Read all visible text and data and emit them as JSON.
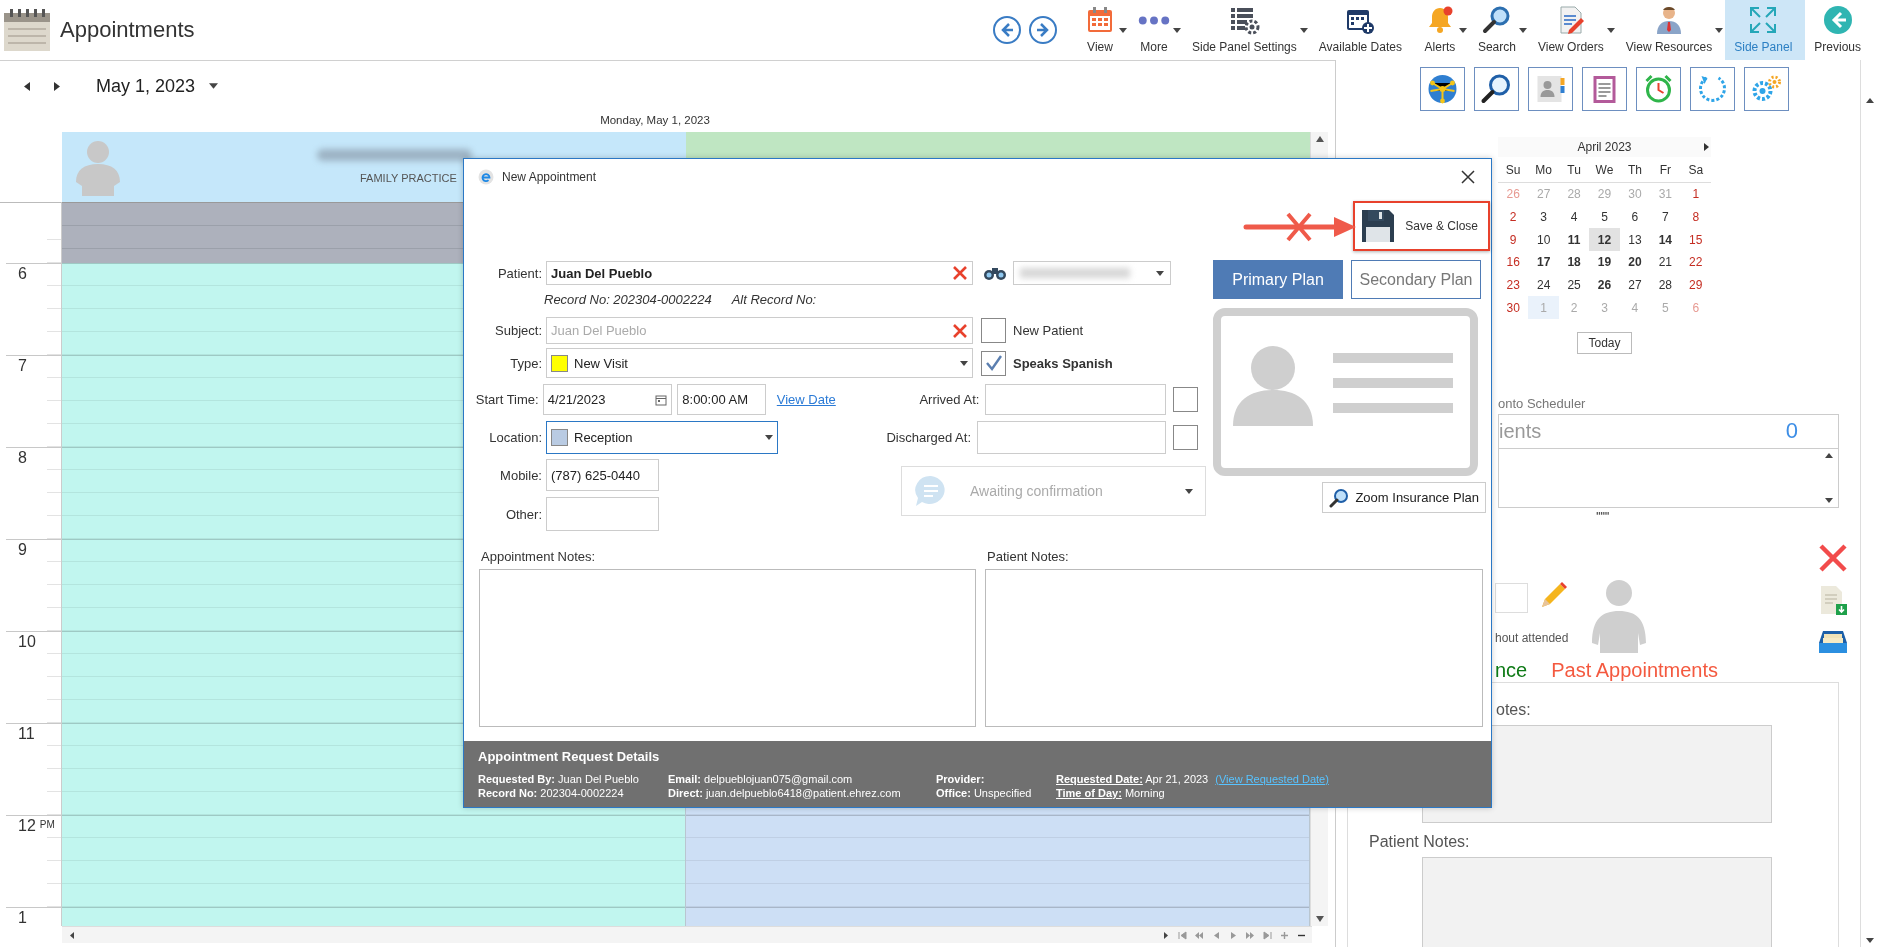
{
  "app": {
    "title": "Appointments"
  },
  "toolbar": [
    {
      "label": "View",
      "kind": "calendar",
      "dropdown": true,
      "selected": false
    },
    {
      "label": "More",
      "kind": "dots",
      "dropdown": true,
      "selected": false
    },
    {
      "label": "Side Panel Settings",
      "kind": "list-gear",
      "dropdown": true,
      "selected": false
    },
    {
      "label": "Available Dates",
      "kind": "calendar-plus",
      "dropdown": false,
      "selected": false
    },
    {
      "label": "Alerts",
      "kind": "bell",
      "dropdown": true,
      "selected": false
    },
    {
      "label": "Search",
      "kind": "search",
      "dropdown": true,
      "selected": false
    },
    {
      "label": "View Orders",
      "kind": "document",
      "dropdown": true,
      "selected": false
    },
    {
      "label": "View Resources",
      "kind": "person",
      "dropdown": true,
      "selected": false
    },
    {
      "label": "Side Panel",
      "kind": "expand",
      "dropdown": false,
      "selected": true
    },
    {
      "label": "Previous",
      "kind": "back",
      "dropdown": false,
      "selected": false
    }
  ],
  "date_nav": {
    "date": "May 1, 2023"
  },
  "scheduler": {
    "day_title": "Monday, May 1, 2023",
    "resources": [
      {
        "subtitle": "FAMILY PRACTICE",
        "header": {
          "color": "#c5e7fa"
        },
        "body": {
          "color": "#c1f6ef"
        }
      },
      {
        "header": {
          "color": "#bfe6c2"
        },
        "body": {
          "color": "#cddff5"
        }
      }
    ],
    "hours": [
      {
        "hour": "6"
      },
      {
        "hour": "7"
      },
      {
        "hour": "8"
      },
      {
        "hour": "9"
      },
      {
        "hour": "10"
      },
      {
        "hour": "11"
      },
      {
        "hour": "12",
        "suffix": "PM"
      },
      {
        "hour": "1"
      }
    ]
  },
  "dialog": {
    "title": "New Appointment",
    "save_button": "Save & Close",
    "patient": {
      "label": "Patient:",
      "value": "Juan Del Pueblo"
    },
    "record_no": "Record No: 202304-0002224",
    "alt_record_no": "Alt Record No:",
    "subject": {
      "label": "Subject:",
      "placeholder": "Juan Del Pueblo"
    },
    "new_patient": {
      "label": "New Patient",
      "checked": false
    },
    "type": {
      "label": "Type:",
      "value": "New Visit",
      "color": "#ffff00"
    },
    "speaks_spanish": {
      "label": "Speaks Spanish",
      "checked": true
    },
    "start_time": {
      "label": "Start Time:",
      "date": "4/21/2023",
      "time": "8:00:00 AM",
      "link": "View Date"
    },
    "arrived_at": {
      "label": "Arrived At:",
      "checked": false
    },
    "location": {
      "label": "Location:",
      "value": "Reception",
      "color": "#b9cbe3"
    },
    "discharged_at": {
      "label": "Discharged At:",
      "checked": false
    },
    "mobile": {
      "label": "Mobile:",
      "value": "(787) 625-0440"
    },
    "other": {
      "label": "Other:"
    },
    "status": {
      "value": "Awaiting confirmation",
      "disabled": true
    },
    "plans": [
      {
        "label": "Primary Plan",
        "selected": true
      },
      {
        "label": "Secondary Plan",
        "selected": false
      }
    ],
    "zoom_button": "Zoom Insurance Plan",
    "appointment_notes": {
      "label": "Appointment Notes:"
    },
    "patient_notes": {
      "label": "Patient Notes:"
    },
    "request_details": {
      "title": "Appointment Request Details",
      "columns": [
        [
          {
            "label": "Requested By:",
            "value": "Juan  Del Pueblo",
            "underlined": false
          },
          {
            "label": "Record No:",
            "value": "202304-0002224",
            "underlined": false
          }
        ],
        [
          {
            "label": "Email:",
            "value": "delpueblojuan075@gmail.com",
            "underlined": false
          },
          {
            "label": "Direct:",
            "value": "juan.delpueblo6418@patient.ehrez.com",
            "underlined": false
          }
        ],
        [
          {
            "label": "Provider:",
            "underlined": false
          },
          {
            "label": "Office:",
            "value": "Unspecified",
            "underlined": false
          }
        ],
        [
          {
            "label": "Requested Date:",
            "value": "Apr 21, 2023",
            "link": "(View Requested Date)",
            "underlined": true
          },
          {
            "label": "Time of Day:",
            "value": "Morning",
            "underlined": true
          }
        ]
      ]
    }
  },
  "side_panel": {
    "calendar": {
      "title": "April 2023",
      "weekdays": [
        "Su",
        "Mo",
        "Tu",
        "We",
        "Th",
        "Fr",
        "Sa"
      ],
      "weeks": [
        [
          {
            "day": "26",
            "muted": true,
            "bold": false,
            "today": false,
            "selected": false
          },
          {
            "day": "27",
            "muted": true,
            "bold": false,
            "today": false,
            "selected": false
          },
          {
            "day": "28",
            "muted": true,
            "bold": false,
            "today": false,
            "selected": false
          },
          {
            "day": "29",
            "muted": true,
            "bold": false,
            "today": false,
            "selected": false
          },
          {
            "day": "30",
            "muted": true,
            "bold": false,
            "today": false,
            "selected": false
          },
          {
            "day": "31",
            "muted": true,
            "bold": false,
            "today": false,
            "selected": false
          },
          {
            "day": "1",
            "muted": false,
            "bold": false,
            "today": false,
            "selected": false
          }
        ],
        [
          {
            "day": "2",
            "muted": false,
            "bold": false,
            "today": false,
            "selected": false
          },
          {
            "day": "3",
            "muted": false,
            "bold": false,
            "today": false,
            "selected": false
          },
          {
            "day": "4",
            "muted": false,
            "bold": false,
            "today": false,
            "selected": false
          },
          {
            "day": "5",
            "muted": false,
            "bold": false,
            "today": false,
            "selected": false
          },
          {
            "day": "6",
            "muted": false,
            "bold": false,
            "today": false,
            "selected": false
          },
          {
            "day": "7",
            "muted": false,
            "bold": false,
            "today": false,
            "selected": false
          },
          {
            "day": "8",
            "muted": false,
            "bold": false,
            "today": false,
            "selected": false
          }
        ],
        [
          {
            "day": "9",
            "muted": false,
            "bold": false,
            "today": false,
            "selected": false
          },
          {
            "day": "10",
            "muted": false,
            "bold": false,
            "today": false,
            "selected": false
          },
          {
            "day": "11",
            "muted": false,
            "bold": true,
            "today": false,
            "selected": false
          },
          {
            "day": "12",
            "muted": false,
            "bold": true,
            "today": true,
            "selected": false
          },
          {
            "day": "13",
            "muted": false,
            "bold": false,
            "today": false,
            "selected": false
          },
          {
            "day": "14",
            "muted": false,
            "bold": true,
            "today": false,
            "selected": false
          },
          {
            "day": "15",
            "muted": false,
            "bold": false,
            "today": false,
            "selected": false
          }
        ],
        [
          {
            "day": "16",
            "muted": false,
            "bold": false,
            "today": false,
            "selected": false
          },
          {
            "day": "17",
            "muted": false,
            "bold": true,
            "today": false,
            "selected": false
          },
          {
            "day": "18",
            "muted": false,
            "bold": true,
            "today": false,
            "selected": false
          },
          {
            "day": "19",
            "muted": false,
            "bold": true,
            "today": false,
            "selected": false
          },
          {
            "day": "20",
            "muted": false,
            "bold": true,
            "today": false,
            "selected": false
          },
          {
            "day": "21",
            "muted": false,
            "bold": false,
            "today": false,
            "selected": false
          },
          {
            "day": "22",
            "muted": false,
            "bold": false,
            "today": false,
            "selected": false
          }
        ],
        [
          {
            "day": "23",
            "muted": false,
            "bold": false,
            "today": false,
            "selected": false
          },
          {
            "day": "24",
            "muted": false,
            "bold": false,
            "today": false,
            "selected": false
          },
          {
            "day": "25",
            "muted": false,
            "bold": false,
            "today": false,
            "selected": false
          },
          {
            "day": "26",
            "muted": false,
            "bold": true,
            "today": false,
            "selected": false
          },
          {
            "day": "27",
            "muted": false,
            "bold": false,
            "today": false,
            "selected": false
          },
          {
            "day": "28",
            "muted": false,
            "bold": false,
            "today": false,
            "selected": false
          },
          {
            "day": "29",
            "muted": false,
            "bold": false,
            "today": false,
            "selected": false
          }
        ],
        [
          {
            "day": "30",
            "muted": false,
            "bold": false,
            "today": false,
            "selected": false
          },
          {
            "day": "1",
            "muted": true,
            "bold": false,
            "today": false,
            "selected": true
          },
          {
            "day": "2",
            "muted": true,
            "bold": false,
            "today": false,
            "selected": false
          },
          {
            "day": "3",
            "muted": true,
            "bold": false,
            "today": false,
            "selected": false
          },
          {
            "day": "4",
            "muted": true,
            "bold": false,
            "today": false,
            "selected": false
          },
          {
            "day": "5",
            "muted": true,
            "bold": false,
            "today": false,
            "selected": false
          },
          {
            "day": "6",
            "muted": true,
            "bold": false,
            "today": false,
            "selected": false
          }
        ]
      ]
    },
    "today_button": "Today",
    "drop_hint": "onto Scheduler",
    "patients_box": {
      "label": "ients",
      "count": "0"
    },
    "attended_hint": "hout attended",
    "tabs": [
      {
        "label": "nce",
        "color": "#0e7a16"
      },
      {
        "label": "Past Appointments",
        "color": "#f4593f"
      }
    ],
    "notes": [
      {
        "label": "otes:"
      },
      {
        "label": "Patient Notes:"
      }
    ]
  }
}
